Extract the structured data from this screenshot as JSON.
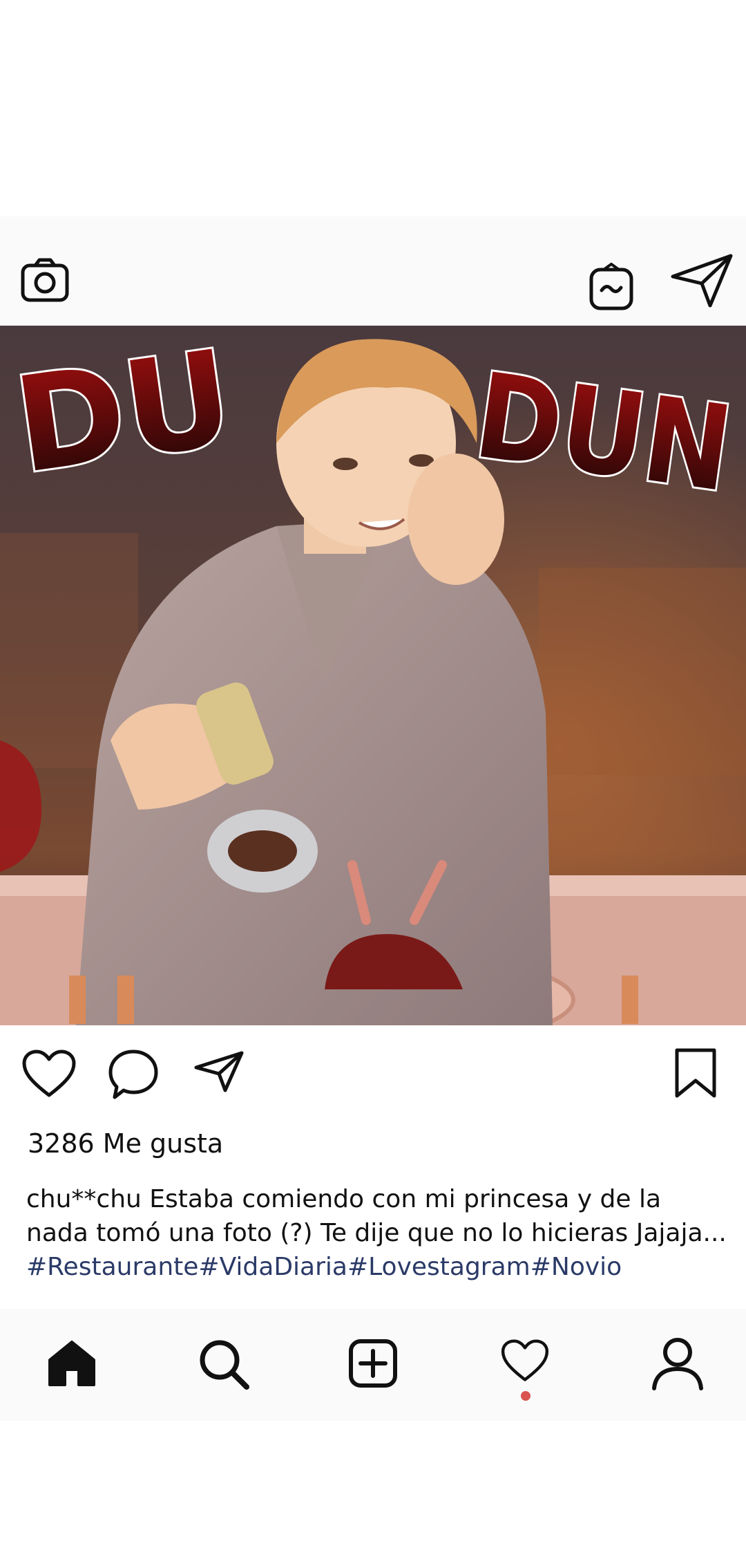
{
  "header": {
    "camera_icon": "camera-icon",
    "igtv_icon": "igtv-icon",
    "direct_icon": "paper-plane-icon"
  },
  "post": {
    "sfx_left": "DU",
    "sfx_right": "DUN",
    "likes_text": "3286 Me gusta",
    "caption_lines": [
      "chu**chu Estaba comiendo con mi princesa y de la",
      "nada tomó una foto (?) Te dije que no lo hicieras Jajaja..."
    ],
    "hashtags": "#Restaurante#VidaDiaria#Lovestagram#Novio"
  },
  "actions": {
    "like_icon": "heart-icon",
    "comment_icon": "comment-icon",
    "share_icon": "paper-plane-icon",
    "save_icon": "bookmark-icon"
  },
  "nav": {
    "items": [
      "home-icon",
      "search-icon",
      "add-post-icon",
      "activity-heart-icon",
      "profile-icon"
    ],
    "notification_color": "#d9534f"
  }
}
